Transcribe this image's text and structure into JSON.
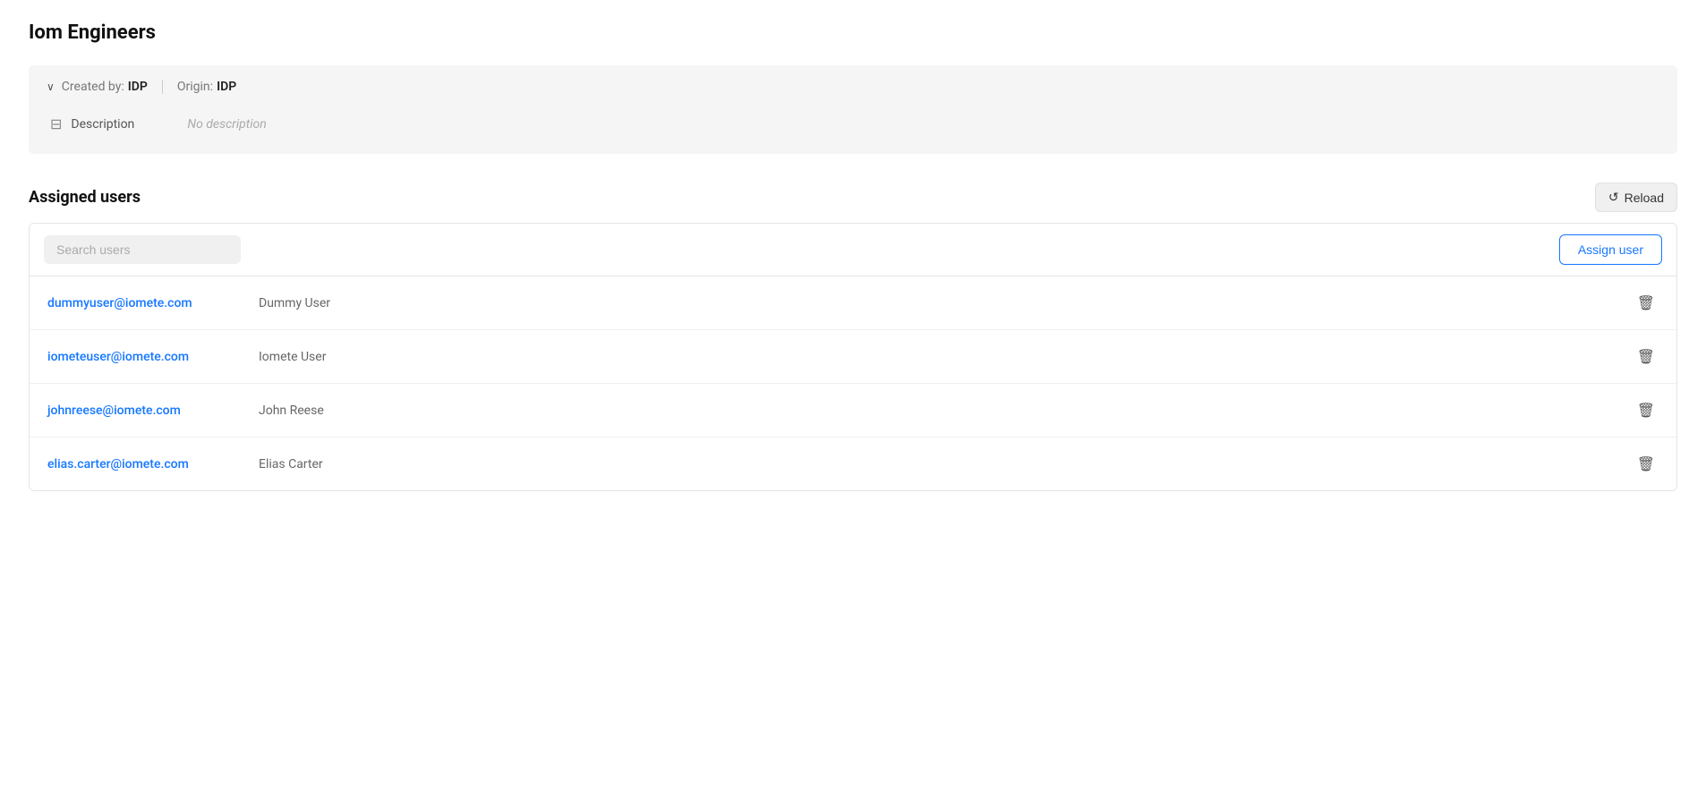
{
  "page": {
    "title": "Iom Engineers"
  },
  "info_panel": {
    "created_by_label": "Created by:",
    "created_by_value": "IDP",
    "origin_label": "Origin:",
    "origin_value": "IDP",
    "description_label": "Description",
    "description_value": "No description"
  },
  "assigned_users": {
    "section_title": "Assigned users",
    "reload_label": "Reload",
    "search_placeholder": "Search users",
    "assign_button_label": "Assign user",
    "users": [
      {
        "email": "dummyuser@iomete.com",
        "name": "Dummy User"
      },
      {
        "email": "iometeuser@iomete.com",
        "name": "Iomete User"
      },
      {
        "email": "johnreese@iomete.com",
        "name": "John Reese"
      },
      {
        "email": "elias.carter@iomete.com",
        "name": "Elias Carter"
      }
    ]
  },
  "icons": {
    "chevron_down": "∨",
    "description": "⊟",
    "reload": "↺",
    "delete": "🗑"
  }
}
